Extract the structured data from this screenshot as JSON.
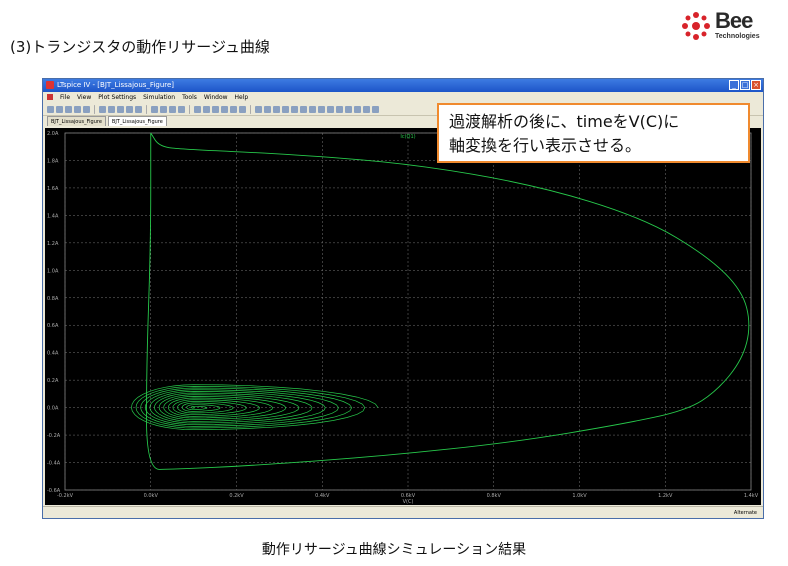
{
  "slide": {
    "title": "(3)トランジスタの動作リサージュ曲線",
    "caption": "動作リサージュ曲線シミュレーション結果",
    "callout_line1": "過渡解析の後に、timeをV(C)に",
    "callout_line2": "軸変換を行い表示させる。",
    "logo_main": "Bee",
    "logo_sub": "Technologies"
  },
  "window": {
    "title": "LTspice IV - [BJT_Lissajous_Figure]",
    "menus": [
      "File",
      "View",
      "Plot Settings",
      "Simulation",
      "Tools",
      "Window",
      "Help"
    ],
    "tabs": [
      "BJT_Lissajous_Figure",
      "BJT_Lissajous_Figure"
    ],
    "status": "Alternate"
  },
  "chart_data": {
    "type": "line",
    "trace_label": "Ic(Q1)",
    "xlabel": "V(C)",
    "x_ticks": [
      "-0.2kV",
      "0.0kV",
      "0.2kV",
      "0.4kV",
      "0.6kV",
      "0.8kV",
      "1.0kV",
      "1.2kV",
      "1.4kV"
    ],
    "y_ticks": [
      "2.0A",
      "1.8A",
      "1.6A",
      "1.4A",
      "1.2A",
      "1.0A",
      "0.8A",
      "0.6A",
      "0.4A",
      "0.2A",
      "0.0A",
      "-0.2A",
      "-0.4A",
      "-0.6A"
    ],
    "xlim": [
      -0.2,
      1.4
    ],
    "ylim": [
      -0.6,
      2.0
    ],
    "grid": true,
    "series_color": "#27c84b",
    "big_loop": [
      [
        0.0,
        2.0
      ],
      [
        0.02,
        1.9
      ],
      [
        0.08,
        1.88
      ],
      [
        0.3,
        1.85
      ],
      [
        0.6,
        1.78
      ],
      [
        0.9,
        1.62
      ],
      [
        1.15,
        1.38
      ],
      [
        1.3,
        1.1
      ],
      [
        1.38,
        0.85
      ],
      [
        1.4,
        0.6
      ],
      [
        1.38,
        0.35
      ],
      [
        1.32,
        0.12
      ],
      [
        1.25,
        -0.02
      ],
      [
        1.1,
        -0.12
      ],
      [
        0.85,
        -0.25
      ],
      [
        0.55,
        -0.35
      ],
      [
        0.25,
        -0.42
      ],
      [
        0.05,
        -0.45
      ],
      [
        -0.01,
        -0.45
      ],
      [
        -0.01,
        0.3
      ],
      [
        0.0,
        1.2
      ],
      [
        0.0,
        2.0
      ]
    ],
    "spiral_center": [
      0.1,
      0.0
    ],
    "spiral_outer": {
      "rx": 0.43,
      "ry": 0.17
    },
    "spiral_turns": 14
  }
}
